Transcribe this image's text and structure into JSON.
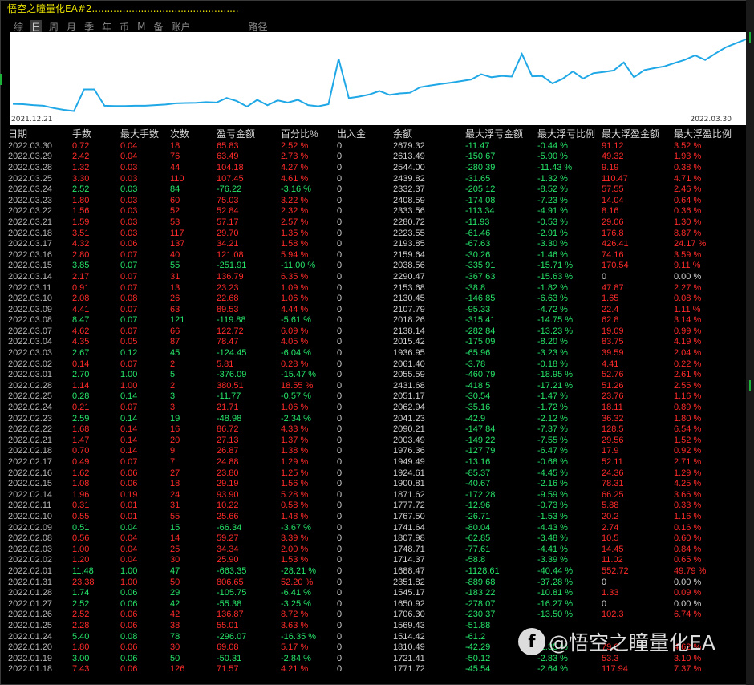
{
  "window": {
    "title": "悟空之瞳量化EA#2................................................"
  },
  "tabs": [
    "综",
    "日",
    "周",
    "月",
    "季",
    "年",
    "币",
    "M",
    "备",
    "账户"
  ],
  "active_tab": 1,
  "path_label": "路径",
  "chart": {
    "start_date": "2021.12.21",
    "end_date": "2022.03.30"
  },
  "columns": [
    "日期",
    "手数",
    "最大手数",
    "次数",
    "盈亏金额",
    "百分比%",
    "出入金",
    "余额",
    "最大浮亏金额",
    "最大浮亏比例",
    "最大浮盈金额",
    "最大浮盈比例"
  ],
  "rows": [
    [
      "2022.03.30",
      "0.72",
      "0.04",
      "18",
      "65.83",
      "2.52 %",
      "0",
      "2679.32",
      "-11.47",
      "-0.44 %",
      "91.12",
      "3.52 %"
    ],
    [
      "2022.03.29",
      "2.42",
      "0.04",
      "76",
      "63.49",
      "2.73 %",
      "0",
      "2613.49",
      "-150.67",
      "-5.90 %",
      "49.32",
      "1.93 %"
    ],
    [
      "2022.03.28",
      "1.32",
      "0.03",
      "44",
      "104.18",
      "4.27 %",
      "0",
      "2544.00",
      "-280.39",
      "-11.43 %",
      "9.19",
      "0.38 %"
    ],
    [
      "2022.03.25",
      "3.30",
      "0.03",
      "110",
      "107.45",
      "4.61 %",
      "0",
      "2439.82",
      "-31.65",
      "-1.32 %",
      "110.47",
      "4.71 %"
    ],
    [
      "2022.03.24",
      "2.52",
      "0.03",
      "84",
      "-76.22",
      "-3.16 %",
      "0",
      "2332.37",
      "-205.12",
      "-8.52 %",
      "57.55",
      "2.46 %"
    ],
    [
      "2022.03.23",
      "1.80",
      "0.03",
      "60",
      "75.03",
      "3.22 %",
      "0",
      "2408.59",
      "-174.08",
      "-7.23 %",
      "14.04",
      "0.64 %"
    ],
    [
      "2022.03.22",
      "1.56",
      "0.03",
      "52",
      "52.84",
      "2.32 %",
      "0",
      "2333.56",
      "-113.34",
      "-4.91 %",
      "8.16",
      "0.36 %"
    ],
    [
      "2022.03.21",
      "1.59",
      "0.03",
      "53",
      "57.17",
      "2.57 %",
      "0",
      "2280.72",
      "-11.93",
      "-0.53 %",
      "29.06",
      "1.30 %"
    ],
    [
      "2022.03.18",
      "3.51",
      "0.03",
      "117",
      "29.70",
      "1.35 %",
      "0",
      "2223.55",
      "-61.46",
      "-2.91 %",
      "176.8",
      "8.87 %"
    ],
    [
      "2022.03.17",
      "4.32",
      "0.06",
      "137",
      "34.21",
      "1.58 %",
      "0",
      "2193.85",
      "-67.63",
      "-3.30 %",
      "426.41",
      "24.17 %"
    ],
    [
      "2022.03.16",
      "2.80",
      "0.07",
      "40",
      "121.08",
      "5.94 %",
      "0",
      "2159.64",
      "-30.26",
      "-1.46 %",
      "74.16",
      "3.59 %"
    ],
    [
      "2022.03.15",
      "3.85",
      "0.07",
      "55",
      "-251.91",
      "-11.00 %",
      "0",
      "2038.56",
      "-335.91",
      "-15.71 %",
      "170.54",
      "9.11 %"
    ],
    [
      "2022.03.14",
      "2.17",
      "0.07",
      "31",
      "136.79",
      "6.35 %",
      "0",
      "2290.47",
      "-367.63",
      "-15.63 %",
      "0",
      "0.00 %"
    ],
    [
      "2022.03.11",
      "0.91",
      "0.07",
      "13",
      "23.23",
      "1.09 %",
      "0",
      "2153.68",
      "-38.8",
      "-1.82 %",
      "47.87",
      "2.27 %"
    ],
    [
      "2022.03.10",
      "2.08",
      "0.08",
      "26",
      "22.68",
      "1.06 %",
      "0",
      "2130.45",
      "-146.85",
      "-6.63 %",
      "1.65",
      "0.08 %"
    ],
    [
      "2022.03.09",
      "4.41",
      "0.07",
      "63",
      "89.53",
      "4.44 %",
      "0",
      "2107.79",
      "-95.33",
      "-4.72 %",
      "22.4",
      "1.11 %"
    ],
    [
      "2022.03.08",
      "8.47",
      "0.07",
      "121",
      "-119.88",
      "-5.61 %",
      "0",
      "2018.26",
      "-315.41",
      "-14.75 %",
      "62.8",
      "3.14 %"
    ],
    [
      "2022.03.07",
      "4.62",
      "0.07",
      "66",
      "122.72",
      "6.09 %",
      "0",
      "2138.14",
      "-282.84",
      "-13.23 %",
      "19.09",
      "0.99 %"
    ],
    [
      "2022.03.04",
      "4.35",
      "0.05",
      "87",
      "78.47",
      "4.05 %",
      "0",
      "2015.42",
      "-175.09",
      "-8.20 %",
      "83.75",
      "4.19 %"
    ],
    [
      "2022.03.03",
      "2.67",
      "0.12",
      "45",
      "-124.45",
      "-6.04 %",
      "0",
      "1936.95",
      "-65.96",
      "-3.23 %",
      "39.59",
      "2.04 %"
    ],
    [
      "2022.03.02",
      "0.14",
      "0.07",
      "2",
      "5.81",
      "0.28 %",
      "0",
      "2061.40",
      "-3.78",
      "-0.18 %",
      "4.41",
      "0.22 %"
    ],
    [
      "2022.03.01",
      "2.70",
      "1.00",
      "5",
      "-376.09",
      "-15.47 %",
      "0",
      "2055.59",
      "-460.79",
      "-18.95 %",
      "52.76",
      "2.61 %"
    ],
    [
      "2022.02.28",
      "1.14",
      "1.00",
      "2",
      "380.51",
      "18.55 %",
      "0",
      "2431.68",
      "-418.5",
      "-17.21 %",
      "51.26",
      "2.55 %"
    ],
    [
      "2022.02.25",
      "0.28",
      "0.14",
      "3",
      "-11.77",
      "-0.57 %",
      "0",
      "2051.17",
      "-30.54",
      "-1.47 %",
      "23.76",
      "1.16 %"
    ],
    [
      "2022.02.24",
      "0.21",
      "0.07",
      "3",
      "21.71",
      "1.06 %",
      "0",
      "2062.94",
      "-35.16",
      "-1.72 %",
      "18.11",
      "0.89 %"
    ],
    [
      "2022.02.23",
      "2.59",
      "0.14",
      "19",
      "-48.98",
      "-2.34 %",
      "0",
      "2041.23",
      "-42.9",
      "-2.12 %",
      "36.32",
      "1.80 %"
    ],
    [
      "2022.02.22",
      "1.68",
      "0.14",
      "16",
      "86.72",
      "4.33 %",
      "0",
      "2090.21",
      "-147.84",
      "-7.37 %",
      "128.5",
      "6.54 %"
    ],
    [
      "2022.02.21",
      "1.47",
      "0.14",
      "20",
      "27.13",
      "1.37 %",
      "0",
      "2003.49",
      "-149.22",
      "-7.55 %",
      "29.56",
      "1.52 %"
    ],
    [
      "2022.02.18",
      "0.70",
      "0.14",
      "9",
      "26.87",
      "1.38 %",
      "0",
      "1976.36",
      "-127.79",
      "-6.47 %",
      "17.9",
      "0.92 %"
    ],
    [
      "2022.02.17",
      "0.49",
      "0.07",
      "7",
      "24.88",
      "1.29 %",
      "0",
      "1949.49",
      "-13.16",
      "-0.68 %",
      "52.11",
      "2.71 %"
    ],
    [
      "2022.02.16",
      "1.62",
      "0.06",
      "27",
      "23.80",
      "1.25 %",
      "0",
      "1924.61",
      "-85.37",
      "-4.45 %",
      "24.36",
      "1.29 %"
    ],
    [
      "2022.02.15",
      "1.08",
      "0.06",
      "18",
      "29.19",
      "1.56 %",
      "0",
      "1900.81",
      "-40.67",
      "-2.16 %",
      "78.31",
      "4.25 %"
    ],
    [
      "2022.02.14",
      "1.96",
      "0.19",
      "24",
      "93.90",
      "5.28 %",
      "0",
      "1871.62",
      "-172.28",
      "-9.59 %",
      "66.25",
      "3.66 %"
    ],
    [
      "2022.02.11",
      "0.31",
      "0.01",
      "31",
      "10.22",
      "0.58 %",
      "0",
      "1777.72",
      "-12.96",
      "-0.73 %",
      "5.88",
      "0.33 %"
    ],
    [
      "2022.02.10",
      "0.55",
      "0.01",
      "55",
      "25.66",
      "1.48 %",
      "0",
      "1767.50",
      "-26.71",
      "-1.53 %",
      "20.2",
      "1.16 %"
    ],
    [
      "2022.02.09",
      "0.51",
      "0.04",
      "15",
      "-66.34",
      "-3.67 %",
      "0",
      "1741.64",
      "-80.04",
      "-4.43 %",
      "2.74",
      "0.16 %"
    ],
    [
      "2022.02.08",
      "0.56",
      "0.04",
      "14",
      "59.27",
      "3.39 %",
      "0",
      "1807.98",
      "-62.85",
      "-3.48 %",
      "10.5",
      "0.60 %"
    ],
    [
      "2022.02.03",
      "1.00",
      "0.04",
      "25",
      "34.34",
      "2.00 %",
      "0",
      "1748.71",
      "-77.61",
      "-4.41 %",
      "14.45",
      "0.84 %"
    ],
    [
      "2022.02.02",
      "1.20",
      "0.04",
      "30",
      "25.90",
      "1.53 %",
      "0",
      "1714.37",
      "-58.8",
      "-3.39 %",
      "11.02",
      "0.65 %"
    ],
    [
      "2022.02.01",
      "11.48",
      "1.00",
      "47",
      "-663.35",
      "-28.21 %",
      "0",
      "1688.47",
      "-1128.61",
      "-40.44 %",
      "552.72",
      "49.79 %"
    ],
    [
      "2022.01.31",
      "23.38",
      "1.00",
      "50",
      "806.65",
      "52.20 %",
      "0",
      "2351.82",
      "-889.68",
      "-37.28 %",
      "0",
      "0.00 %"
    ],
    [
      "2022.01.28",
      "1.74",
      "0.06",
      "29",
      "-105.75",
      "-6.41 %",
      "0",
      "1545.17",
      "-183.22",
      "-10.81 %",
      "1.33",
      "0.09 %"
    ],
    [
      "2022.01.27",
      "2.52",
      "0.06",
      "42",
      "-55.38",
      "-3.25 %",
      "0",
      "1650.92",
      "-278.07",
      "-16.27 %",
      "0",
      "0.00 %"
    ],
    [
      "2022.01.26",
      "2.52",
      "0.06",
      "42",
      "136.87",
      "8.72 %",
      "0",
      "1706.30",
      "-230.37",
      "-13.50 %",
      "102.3",
      "6.74 %"
    ],
    [
      "2022.01.25",
      "2.28",
      "0.06",
      "38",
      "55.01",
      "3.63 %",
      "0",
      "1569.43",
      "-51.88",
      "",
      "",
      ""
    ],
    [
      "2022.01.24",
      "5.40",
      "0.08",
      "78",
      "-296.07",
      "-16.35 %",
      "0",
      "1514.42",
      "-61.2",
      "",
      "",
      ""
    ],
    [
      "2022.01.20",
      "1.80",
      "0.06",
      "30",
      "69.08",
      "5.17 %",
      "0",
      "1810.49",
      "-42.29",
      "-2.35 %",
      "79.6",
      "4.62 %"
    ],
    [
      "2022.01.19",
      "3.00",
      "0.06",
      "50",
      "-50.31",
      "-2.84 %",
      "0",
      "1721.41",
      "-50.12",
      "-2.83 %",
      "53.3",
      "3.10 %"
    ],
    [
      "2022.01.18",
      "7.43",
      "0.06",
      "126",
      "71.57",
      "4.21 %",
      "0",
      "1771.72",
      "-45.54",
      "-2.64 %",
      "117.94",
      "7.37 %"
    ]
  ],
  "chart_data": {
    "type": "line",
    "x_start": "2021.12.21",
    "x_end": "2022.03.30",
    "values": [
      1590,
      1585,
      1570,
      1560,
      1520,
      1490,
      1470,
      1835,
      1835,
      1560,
      1555,
      1555,
      1560,
      1560,
      1570,
      1580,
      1600,
      1605,
      1610,
      1620,
      1614,
      1690,
      1638,
      1545,
      1660,
      1568,
      1650,
      1612,
      1660,
      1570,
      1550,
      1585,
      2350,
      1688,
      1714,
      1748,
      1808,
      1742,
      1768,
      1778,
      1872,
      1901,
      1925,
      1949,
      1976,
      2003,
      2090,
      2041,
      2063,
      2051,
      2432,
      2056,
      2061,
      1937,
      2015,
      2138,
      2018,
      2108,
      2130,
      2154,
      2290,
      2039,
      2160,
      2194,
      2224,
      2281,
      2334,
      2409,
      2332,
      2440,
      2544,
      2613,
      2679
    ]
  },
  "watermark": {
    "logo": "f",
    "text": "@悟空之瞳量化EA"
  }
}
